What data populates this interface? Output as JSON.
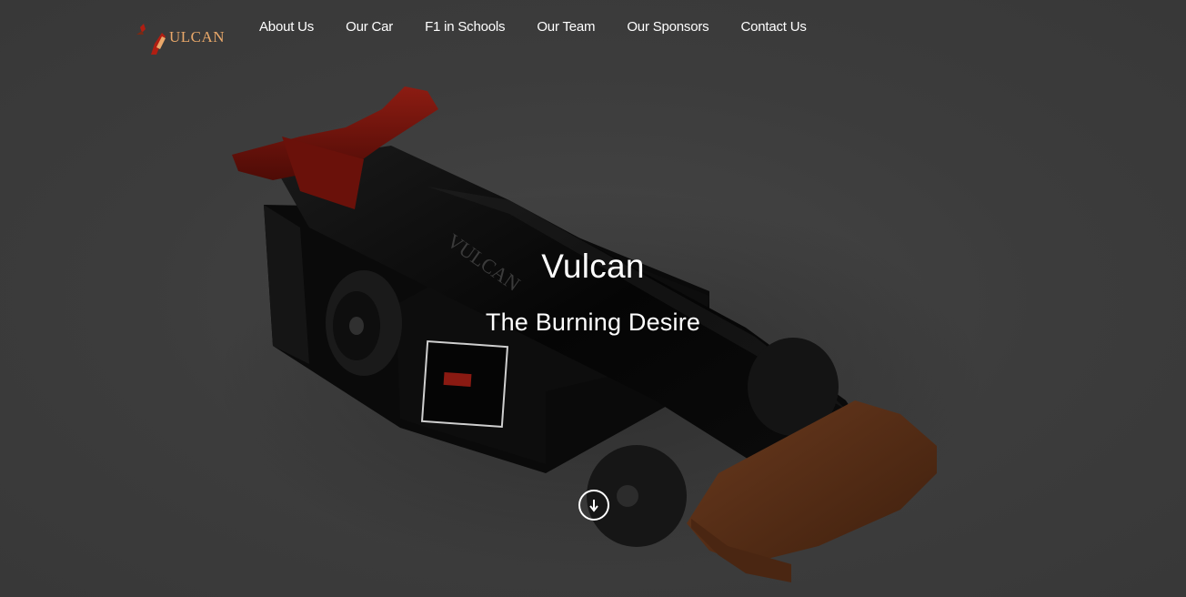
{
  "brand": {
    "logo_text": "ULCAN",
    "logo_color": "#e9a86a",
    "accent_red": "#b01e12"
  },
  "nav": {
    "items": [
      {
        "label": "About Us"
      },
      {
        "label": "Our Car"
      },
      {
        "label": "F1 in Schools"
      },
      {
        "label": "Our Team"
      },
      {
        "label": "Our Sponsors"
      },
      {
        "label": "Contact Us"
      }
    ]
  },
  "hero": {
    "title": "Vulcan",
    "subtitle": "The Burning Desire",
    "car_side_text": "VULCAN",
    "scroll_icon": "arrow-down-circle-icon"
  }
}
